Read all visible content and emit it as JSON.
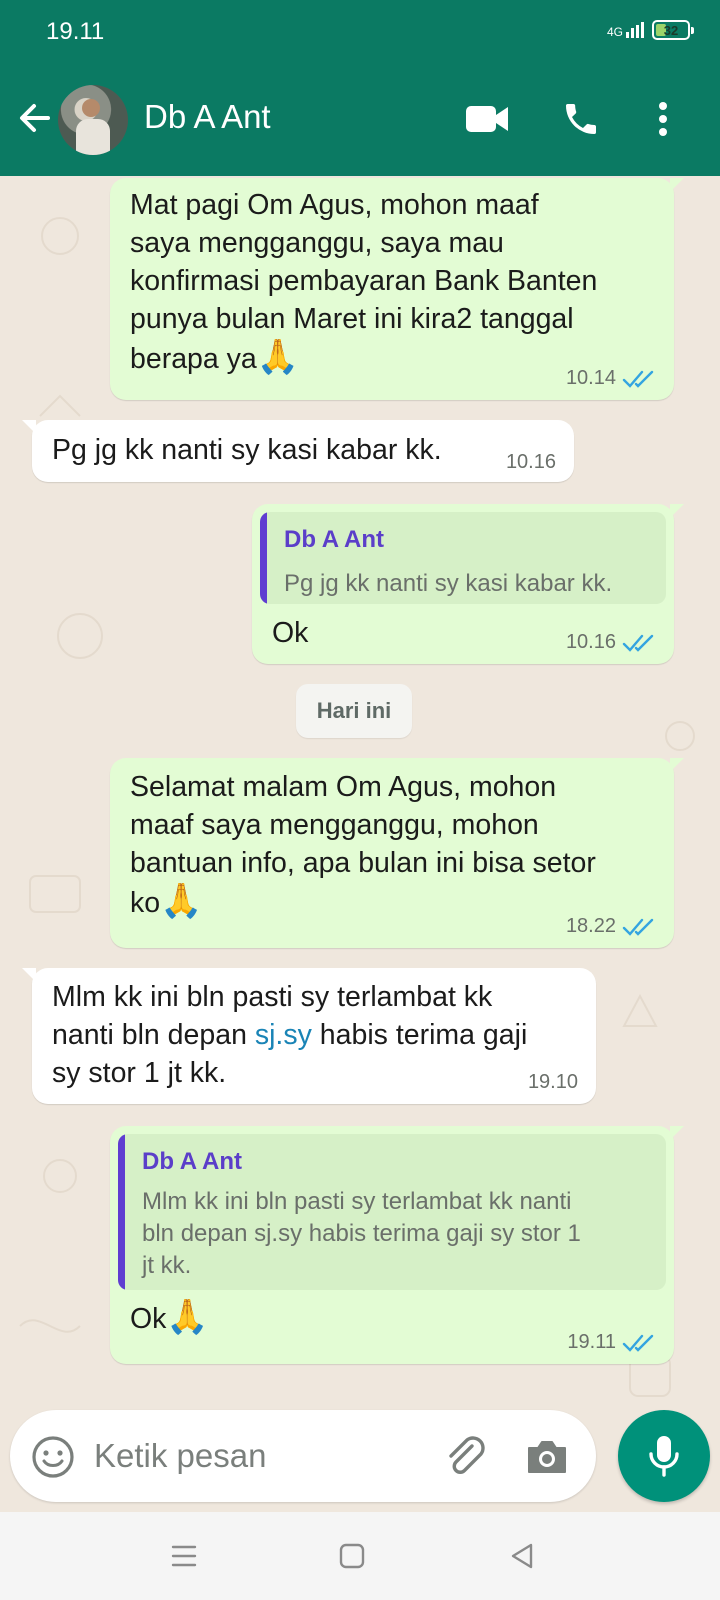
{
  "status_bar": {
    "time": "19.11",
    "network": "4G",
    "battery": "32",
    "battery_level": 0.32
  },
  "header": {
    "contact_name": "Db A Ant"
  },
  "messages": [
    {
      "direction": "out",
      "text_lines": [
        "Mat pagi Om Agus, mohon maaf",
        "saya mengganggu, saya mau",
        "konfirmasi pembayaran Bank Banten",
        "punya bulan Maret ini kira2 tanggal",
        "berapa ya"
      ],
      "emoji": "🙏",
      "time": "10.14",
      "status": "read"
    },
    {
      "direction": "in",
      "text": "Pg jg kk nanti sy kasi kabar kk.",
      "time": "10.16"
    },
    {
      "direction": "out",
      "quote": {
        "name": "Db A Ant",
        "text": "Pg jg kk nanti sy kasi kabar kk."
      },
      "text": "Ok",
      "time": "10.16",
      "status": "read"
    },
    {
      "direction": "out",
      "text_lines": [
        "Selamat malam Om Agus, mohon",
        "maaf saya mengganggu, mohon",
        "bantuan info, apa bulan ini bisa setor",
        "ko"
      ],
      "emoji": "🙏",
      "time": "18.22",
      "status": "read"
    },
    {
      "direction": "in",
      "text_lines": [
        "Mlm kk ini bln pasti sy terlambat kk",
        "nanti bln depan",
        "sj.sy",
        "habis terima gaji",
        "sy stor 1 jt kk."
      ],
      "time": "19.10"
    },
    {
      "direction": "out",
      "quote": {
        "name": "Db A Ant",
        "text_lines": [
          "Mlm kk ini bln pasti sy terlambat kk nanti",
          "bln depan sj.sy habis terima gaji sy stor 1",
          "jt kk."
        ]
      },
      "text": "Ok",
      "emoji": "🙏",
      "time": "19.11",
      "status": "read"
    }
  ],
  "date_separator": "Hari ini",
  "composer": {
    "placeholder": "Ketik pesan"
  },
  "colors": {
    "header": "#0b7a63",
    "outgoing_bubble": "#e3fcd4",
    "incoming_bubble": "#ffffff",
    "read_ticks": "#34a4e0",
    "quote_name": "#5b3ec9",
    "mic_button": "#00917a"
  },
  "icons": [
    "back-arrow-icon",
    "video-call-icon",
    "phone-call-icon",
    "more-options-icon",
    "emoji-icon",
    "attach-icon",
    "camera-icon",
    "mic-icon",
    "nav-menu-icon",
    "nav-home-icon",
    "nav-back-icon"
  ]
}
